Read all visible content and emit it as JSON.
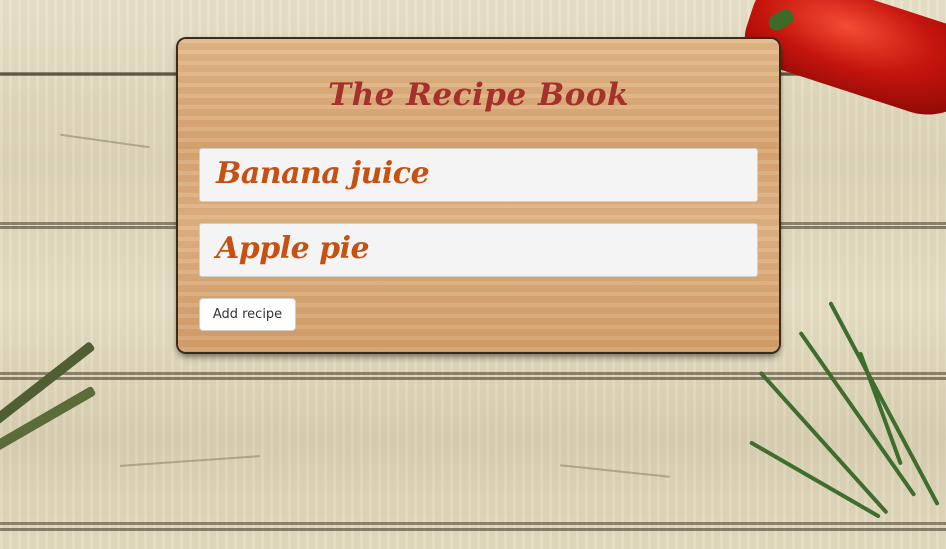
{
  "app": {
    "title": "The Recipe Book"
  },
  "recipes": [
    {
      "name": "Banana juice"
    },
    {
      "name": "Apple pie"
    }
  ],
  "actions": {
    "add_label": "Add recipe"
  },
  "colors": {
    "title": "#a6302b",
    "recipe_name": "#c55213",
    "card_wood": "#dcad7c",
    "table_wood": "#e6dec4"
  }
}
